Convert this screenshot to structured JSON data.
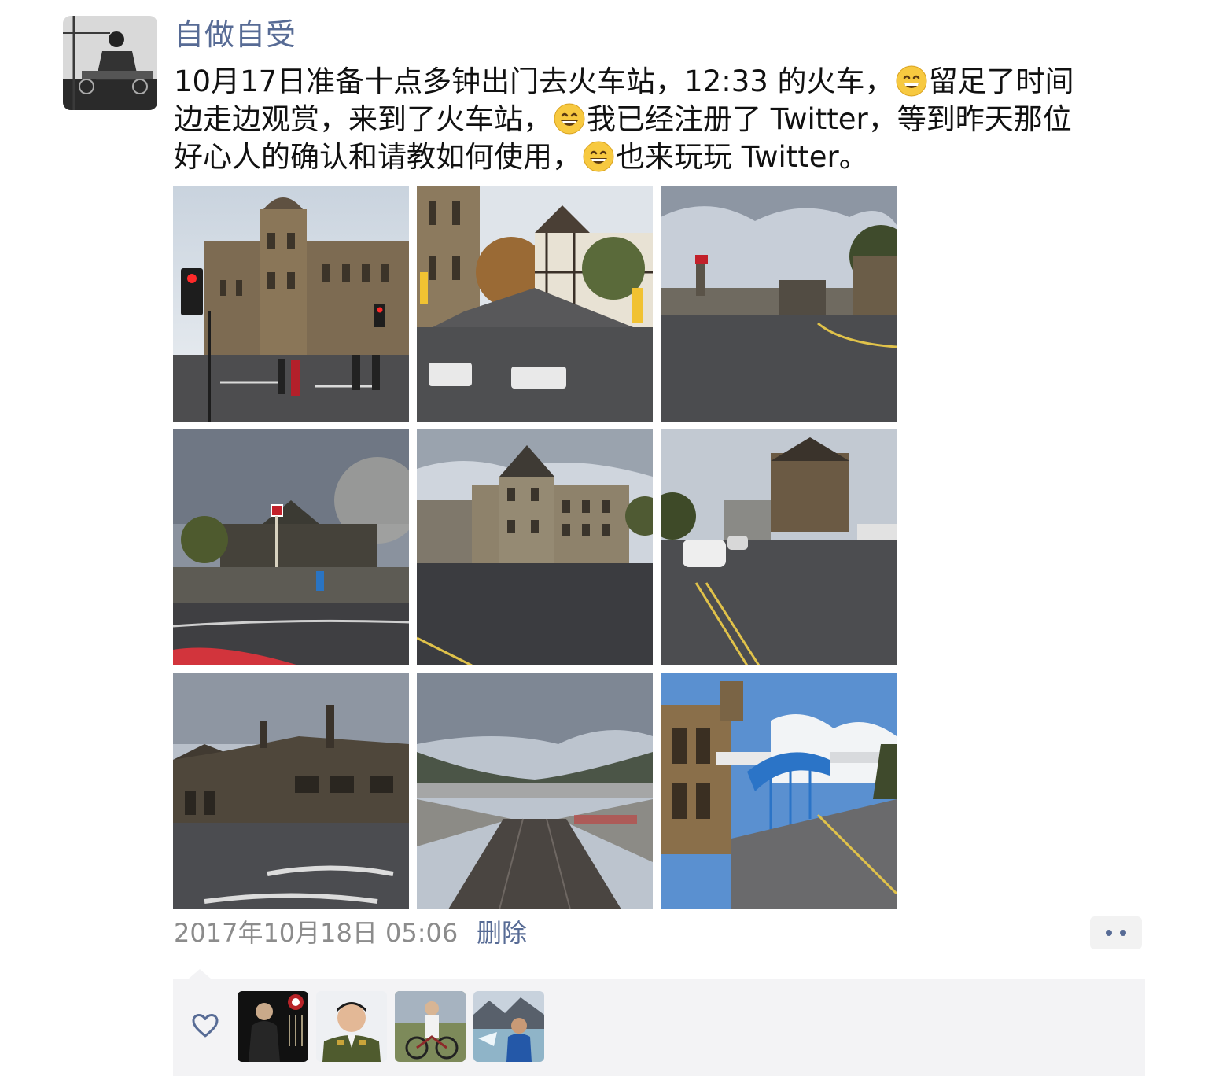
{
  "post": {
    "author": "自做自受",
    "avatar": {
      "icon": "avatar-icon",
      "caption": ""
    },
    "text_segments": [
      {
        "text": "10月17日准备十点多钟出门去火车站，12:33 的火车，"
      },
      {
        "emoji": "grinning-face"
      },
      {
        "text": "留足了时间"
      },
      {
        "text": "边走边观赏，来到了火车站，"
      },
      {
        "emoji": "grinning-face"
      },
      {
        "text": "我已经注册了 Twitter，等到昨天那位"
      },
      {
        "text": "好心人的确认和请教如何使用，"
      },
      {
        "emoji": "grinning-face"
      },
      {
        "text": "也来玩玩 Twitter。"
      }
    ],
    "text": {
      "line1_a": "10月17日准备十点多钟出门去火车站，12:33 的火车，",
      "line1_b": "留足了时间",
      "line2_a": "边走边观赏，来到了火车站，",
      "line2_b": "我已经注册了 Twitter，等到昨天那位",
      "line3_a": "好心人的确认和请教如何使用，",
      "line3_b": "也来玩玩 Twitter。"
    },
    "photos": [
      {
        "name": "street-town-hall-photo"
      },
      {
        "name": "cobbled-street-photo"
      },
      {
        "name": "station-road-photo"
      },
      {
        "name": "railway-sign-photo"
      },
      {
        "name": "stone-building-photo"
      },
      {
        "name": "parked-cars-street-photo"
      },
      {
        "name": "stone-house-photo"
      },
      {
        "name": "railway-tracks-photo"
      },
      {
        "name": "station-platform-photo"
      }
    ],
    "timestamp": "2017年10月18日 05:06",
    "delete_label": "删除",
    "more_icon": "more-dots-icon"
  },
  "likes": {
    "heart_icon": "heart-icon",
    "likers": [
      {
        "name": "liker-avatar-1"
      },
      {
        "name": "liker-avatar-2"
      },
      {
        "name": "liker-avatar-3"
      },
      {
        "name": "liker-avatar-4"
      }
    ]
  },
  "colors": {
    "link": "#576b95",
    "text": "#111111",
    "muted": "#8c8c8c",
    "likes_bg": "#f3f3f5"
  }
}
